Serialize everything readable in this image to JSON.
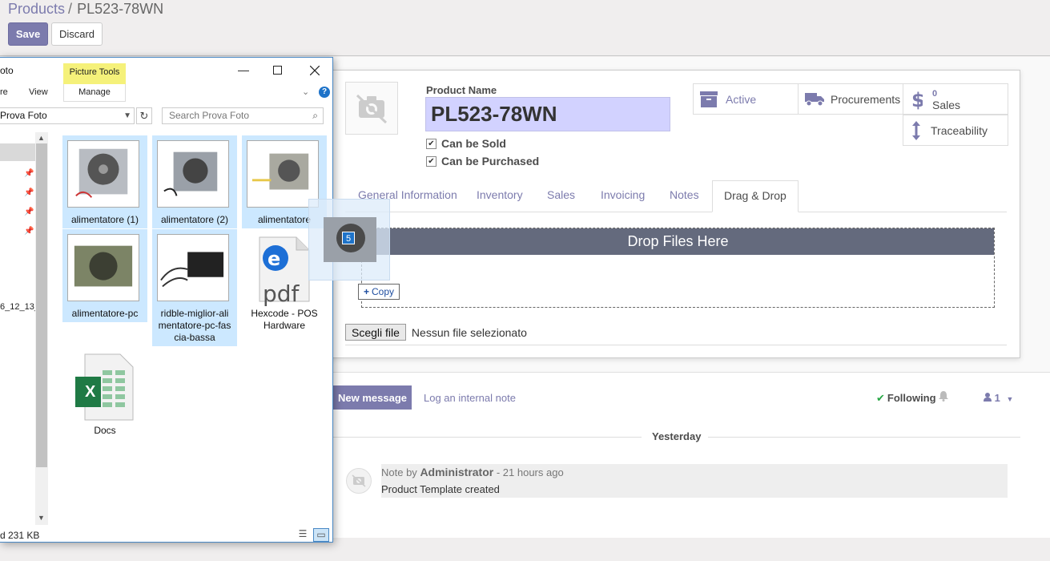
{
  "breadcrumb": {
    "parent": "Products",
    "separator": "/",
    "current": "PL523-78WN"
  },
  "toolbar": {
    "save_label": "Save",
    "discard_label": "Discard"
  },
  "form": {
    "product_name_label": "Product Name",
    "product_name": "PL523-78WN",
    "can_be_sold": "Can be Sold",
    "can_be_purchased": "Can be Purchased",
    "smart_buttons": {
      "active": "Active",
      "procurements": "Procurements",
      "sales_count": "0",
      "sales_label": "Sales",
      "traceability": "Traceability"
    },
    "tabs": [
      "General Information",
      "Inventory",
      "Sales",
      "Invoicing",
      "Notes",
      "Drag & Drop"
    ],
    "active_tab": "Drag & Drop",
    "drop_zone_label": "Drop Files Here",
    "copy_tooltip": "Copy",
    "file_button": "Scegli file",
    "file_status": "Nessun file selezionato"
  },
  "chatter": {
    "new_message": "New message",
    "log_note": "Log an internal note",
    "following": "Following",
    "followers_count": "1",
    "day_separator": "Yesterday",
    "message": {
      "prefix": "Note by",
      "author": "Administrator",
      "time": "- 21 hours ago",
      "body": "Product Template created"
    }
  },
  "explorer": {
    "title_partial": "oto",
    "picture_tools": "Picture Tools",
    "ribbon_tabs": [
      "re",
      "View",
      "Manage"
    ],
    "address": "Prova Foto",
    "search_placeholder": "Search Prova Foto",
    "nav_partial_text": "6_12_13_",
    "items": [
      {
        "name": "alimentatore (1)",
        "selected": true
      },
      {
        "name": "alimentatore (2)",
        "selected": true
      },
      {
        "name": "alimentatore",
        "selected": true
      },
      {
        "name": "alimentatore-pc",
        "selected": true
      },
      {
        "name": "ridble-miglior-ali mentatore-pc-fas cia-bassa",
        "selected": true
      },
      {
        "name": "Hexcode - POS Hardware",
        "selected": false
      },
      {
        "name": "Docs",
        "selected": false
      }
    ],
    "pdf_label": "pdf",
    "excel_letter": "X",
    "status_text": "d  231 KB",
    "drag_count": "5"
  },
  "colors": {
    "brand": "#7c7bad",
    "drop_header": "#646a7d",
    "name_field": "#d2d2ff",
    "selection": "#cce8ff",
    "picture_tools": "#f5f17a"
  },
  "icons": {
    "active": "archive-icon",
    "procurements": "truck-icon",
    "sales": "dollar-icon",
    "traceability": "arrows-vertical-icon",
    "following": "check-icon",
    "bell": "bell-icon",
    "followers": "user-icon"
  }
}
